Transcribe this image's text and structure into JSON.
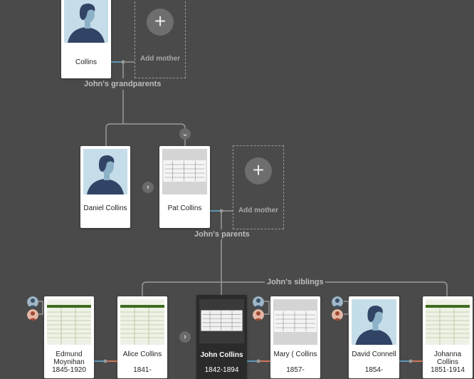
{
  "grandparents": {
    "label": "John's grandparents",
    "father": {
      "name": "Collins"
    },
    "add_mother_label": "Add mother",
    "add_symbol": "+"
  },
  "parents": {
    "label": "John's parents",
    "father": {
      "name": "Daniel Collins"
    },
    "mother": {
      "name": "Pat Collins"
    },
    "add_mother_label": "Add mother",
    "add_symbol": "+"
  },
  "siblings": {
    "label": "John's siblings",
    "people": [
      {
        "name": "Edmund Moynihan",
        "years": "1845-1920"
      },
      {
        "name": "Alice Collins",
        "years": "1841-"
      },
      {
        "name": "John Collins",
        "years": "1842-1894"
      },
      {
        "name": "Mary ( Collins",
        "years": "1857-"
      },
      {
        "name": "David Connell",
        "years": "1854-"
      },
      {
        "name": "Johanna Collins",
        "years": "1851-1914"
      }
    ]
  },
  "controls": {
    "expand_symbol": "›",
    "collapse_symbol": "⌄"
  },
  "colors": {
    "background": "#4a4a4a",
    "line": "#9a9a9a",
    "male_link": "#5b9bbf",
    "female_link": "#d9785a",
    "selected_card": "#2b2b2b"
  },
  "icons": {
    "male_silhouette": "male-silhouette-icon",
    "record_document": "record-document-icon",
    "plus": "plus-icon",
    "chevron_right": "chevron-right-icon",
    "chevron_down": "chevron-down-icon"
  }
}
